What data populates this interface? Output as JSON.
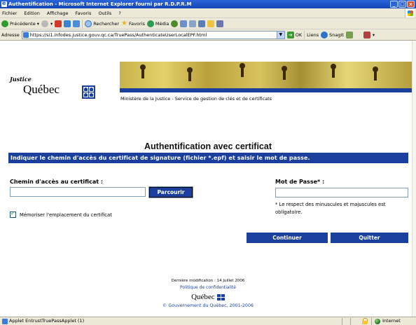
{
  "window": {
    "title": "Authentification - Microsoft Internet Explorer fourni par R.D.P.R.M",
    "minimize": "_",
    "maximize": "□",
    "close": "x"
  },
  "menu": {
    "items": [
      "Fichier",
      "Edition",
      "Affichage",
      "Favoris",
      "Outils",
      "?"
    ]
  },
  "toolbar": {
    "back": "Précédente",
    "search": "Rechercher",
    "favorites": "Favoris",
    "media": "Média"
  },
  "address": {
    "label": "Adresse",
    "url": "https://si1.infodes.justice.gouv.qc.ca/TruePass/AuthenticateUserLocalEPF.html",
    "go": "OK",
    "links": "Liens",
    "snagit": "SnagIt"
  },
  "header": {
    "logo_top": "Justice",
    "logo_main": "Québec",
    "ministry": "Ministère de la Justice - Service de gestion de clés et de certificats"
  },
  "form": {
    "heading": "Authentification avec certificat",
    "instruction": "Indiquer le chemin d'accès du certificat de signature (fichier *.epf) et saisir le mot de passe.",
    "cert_label": "Chemin d'accès au certificat :",
    "cert_value": "",
    "browse_label": "Parcourir",
    "password_label": "Mot de Passe* :",
    "password_value": "",
    "password_note": "* Le respect des minuscules et majuscules est obligatoire.",
    "remember_label": "Mémoriser l'emplacement du certificat",
    "remember_checked": true,
    "continue_label": "Continuer",
    "quit_label": "Quitter"
  },
  "footer": {
    "last_modified": "Dernière modification : 14 Juillet 2006",
    "privacy": "Politique de confidentialité",
    "brand": "Québec",
    "copyright": "© Gouvernement du Québec, 2001-2006"
  },
  "status": {
    "text": "Applet EntrustTruePassApplet (1)",
    "zone": "Internet"
  },
  "colors": {
    "brand_blue": "#1a3f9c",
    "titlebar": "#2a63d8"
  }
}
